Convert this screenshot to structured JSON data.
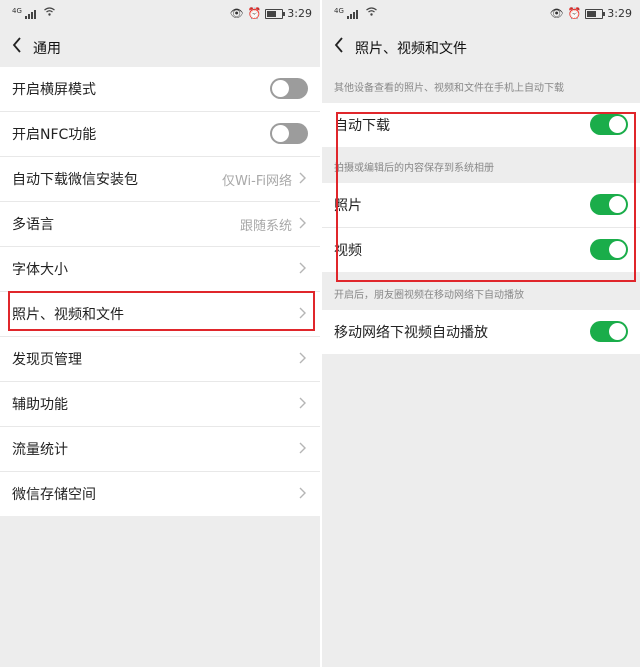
{
  "status": {
    "time": "3:29",
    "signal": "4G"
  },
  "left": {
    "title": "通用",
    "rows": [
      {
        "label": "开启横屏模式",
        "toggle": "off"
      },
      {
        "label": "开启NFC功能",
        "toggle": "off"
      },
      {
        "label": "自动下载微信安装包",
        "value": "仅Wi-Fi网络"
      },
      {
        "label": "多语言",
        "value": "跟随系统"
      },
      {
        "label": "字体大小"
      },
      {
        "label": "照片、视频和文件",
        "highlighted": true
      },
      {
        "label": "发现页管理"
      },
      {
        "label": "辅助功能"
      },
      {
        "label": "流量统计"
      },
      {
        "label": "微信存储空间"
      }
    ]
  },
  "right": {
    "title": "照片、视频和文件",
    "hint1": "其他设备查看的照片、视频和文件在手机上自动下载",
    "auto_download": {
      "label": "自动下载",
      "toggle": "on"
    },
    "hint2": "拍摄或编辑后的内容保存到系统相册",
    "photo": {
      "label": "照片",
      "toggle": "on"
    },
    "video": {
      "label": "视频",
      "toggle": "on"
    },
    "hint3": "开启后，朋友圈视频在移动网络下自动播放",
    "autoplay": {
      "label": "移动网络下视频自动播放",
      "toggle": "on"
    }
  },
  "colors": {
    "accent_green": "#1aad4a",
    "highlight_red": "#e0262b",
    "toggle_off": "#9c9c9c"
  }
}
